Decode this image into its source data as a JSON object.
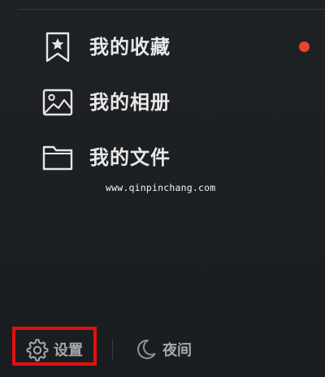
{
  "menu": {
    "items": [
      {
        "label": "我的收藏",
        "icon": "bookmark-star-icon"
      },
      {
        "label": "我的相册",
        "icon": "image-icon"
      },
      {
        "label": "我的文件",
        "icon": "folder-icon"
      }
    ],
    "notification_dot_color": "#e8452c"
  },
  "watermark": {
    "text": "www.qinpinchang.com"
  },
  "bottom_bar": {
    "settings_label": "设置",
    "settings_icon": "gear-icon",
    "night_label": "夜间",
    "night_icon": "moon-icon",
    "highlight_color": "#e01010"
  }
}
